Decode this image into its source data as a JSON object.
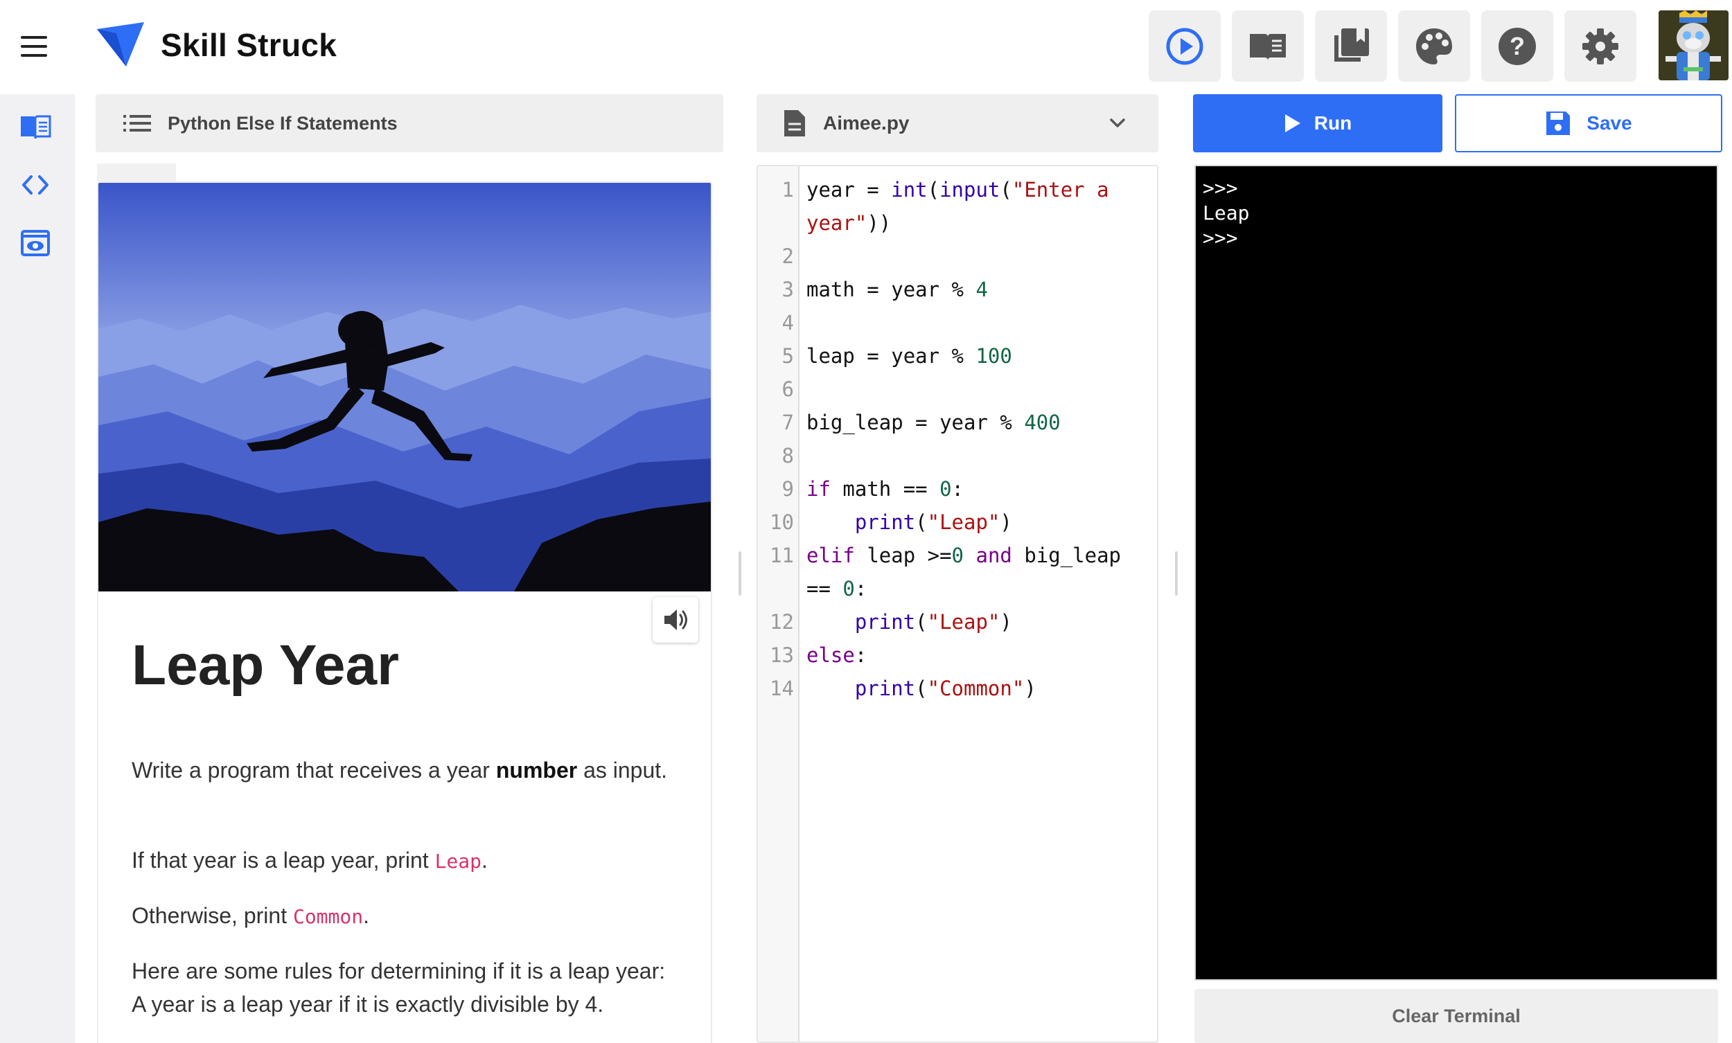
{
  "header": {
    "brand": "Skill Struck",
    "toolbar": [
      {
        "icon": "play-circle-icon"
      },
      {
        "icon": "book-icon"
      },
      {
        "icon": "library-icon"
      },
      {
        "icon": "palette-icon"
      },
      {
        "icon": "help-icon"
      },
      {
        "icon": "gear-icon"
      }
    ]
  },
  "rail": {
    "items": [
      {
        "icon": "lesson-book-icon"
      },
      {
        "icon": "code-icon"
      },
      {
        "icon": "preview-icon"
      }
    ]
  },
  "lesson": {
    "header_title": "Python Else If Statements",
    "title": "Leap Year",
    "p1_a": "Write a program that receives a year ",
    "p1_bold": "number",
    "p1_b": " as input.",
    "p2_a": "If that year is a leap year, print ",
    "p2_code": "Leap",
    "p2_b": ".",
    "p3_a": "Otherwise, print ",
    "p3_code": "Common",
    "p3_b": ".",
    "p4": "Here are some rules for determining if it is a leap year: A year is a leap year if it is exactly divisible by 4."
  },
  "editor": {
    "filename": "Aimee.py",
    "lines": [
      {
        "n": "1",
        "text": "year = int(input(\"Enter a year\"))"
      },
      {
        "n": "2",
        "text": ""
      },
      {
        "n": "3",
        "text": "math = year % 4"
      },
      {
        "n": "4",
        "text": ""
      },
      {
        "n": "5",
        "text": "leap = year % 100"
      },
      {
        "n": "6",
        "text": ""
      },
      {
        "n": "7",
        "text": "big_leap = year % 400"
      },
      {
        "n": "8",
        "text": ""
      },
      {
        "n": "9",
        "text": "if math == 0:"
      },
      {
        "n": "10",
        "text": "    print(\"Leap\")"
      },
      {
        "n": "11",
        "text": "elif leap >=0 and big_leap == 0:"
      },
      {
        "n": "12",
        "text": "    print(\"Leap\")"
      },
      {
        "n": "13",
        "text": "else:"
      },
      {
        "n": "14",
        "text": "    print(\"Common\")"
      }
    ]
  },
  "run": {
    "run_label": "Run",
    "save_label": "Save",
    "terminal_lines": [
      ">>>",
      "Leap",
      ">>>"
    ],
    "clear_label": "Clear Terminal"
  },
  "colors": {
    "accent": "#2e6ef5",
    "terminal_bg": "#000000",
    "keyword": "#770088",
    "builtin": "#3300aa",
    "string": "#aa1111",
    "number": "#116644",
    "inline_code": "#d6336c"
  }
}
